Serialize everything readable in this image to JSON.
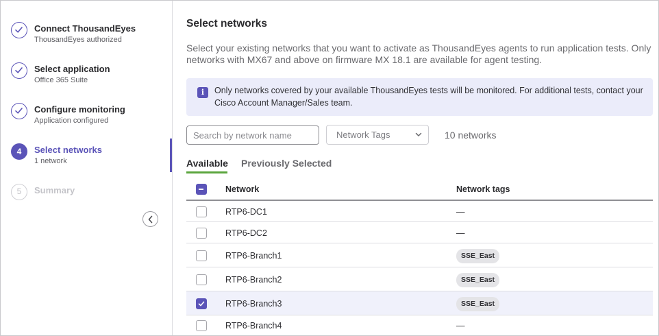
{
  "steps": [
    {
      "title": "Connect ThousandEyes",
      "subtitle": "ThousandEyes authorized",
      "state": "done"
    },
    {
      "title": "Select application",
      "subtitle": "Office 365 Suite",
      "state": "done"
    },
    {
      "title": "Configure monitoring",
      "subtitle": "Application configured",
      "state": "done"
    },
    {
      "number": "4",
      "title": "Select networks",
      "subtitle": "1 network",
      "state": "active"
    },
    {
      "number": "5",
      "title": "Summary",
      "subtitle": "",
      "state": "pending"
    }
  ],
  "main": {
    "title": "Select networks",
    "description": "Select your existing networks that you want to activate as ThousandEyes agents to run application tests. Only networks with MX67 and above on firmware MX 18.1 are available for agent testing.",
    "info_text": "Only networks covered by your available ThousandEyes tests will be monitored. For additional tests, contact your Cisco Account Manager/Sales team.",
    "search_placeholder": "Search by network name",
    "tags_placeholder": "Network Tags",
    "count_text": "10 networks",
    "tabs": [
      {
        "label": "Available",
        "active": true
      },
      {
        "label": "Previously Selected",
        "active": false
      }
    ]
  },
  "table": {
    "headers": {
      "network": "Network",
      "tags": "Network tags"
    },
    "select_all_state": "indeterminate",
    "rows": [
      {
        "network": "RTP6-DC1",
        "tag": "—",
        "tag_is_chip": false,
        "checked": false
      },
      {
        "network": "RTP6-DC2",
        "tag": "—",
        "tag_is_chip": false,
        "checked": false
      },
      {
        "network": "RTP6-Branch1",
        "tag": "SSE_East",
        "tag_is_chip": true,
        "checked": false
      },
      {
        "network": "RTP6-Branch2",
        "tag": "SSE_East",
        "tag_is_chip": true,
        "checked": false
      },
      {
        "network": "RTP6-Branch3",
        "tag": "SSE_East",
        "tag_is_chip": true,
        "checked": true
      },
      {
        "network": "RTP6-Branch4",
        "tag": "—",
        "tag_is_chip": false,
        "checked": false
      }
    ]
  },
  "colors": {
    "accent": "#5b54b8",
    "tab_underline": "#5aa53c",
    "info_bg": "#ebecfa"
  },
  "icons": {
    "done_step": "check-icon",
    "collapse": "chevron-left-icon",
    "info": "info-icon",
    "select": "chevron-down-icon"
  }
}
